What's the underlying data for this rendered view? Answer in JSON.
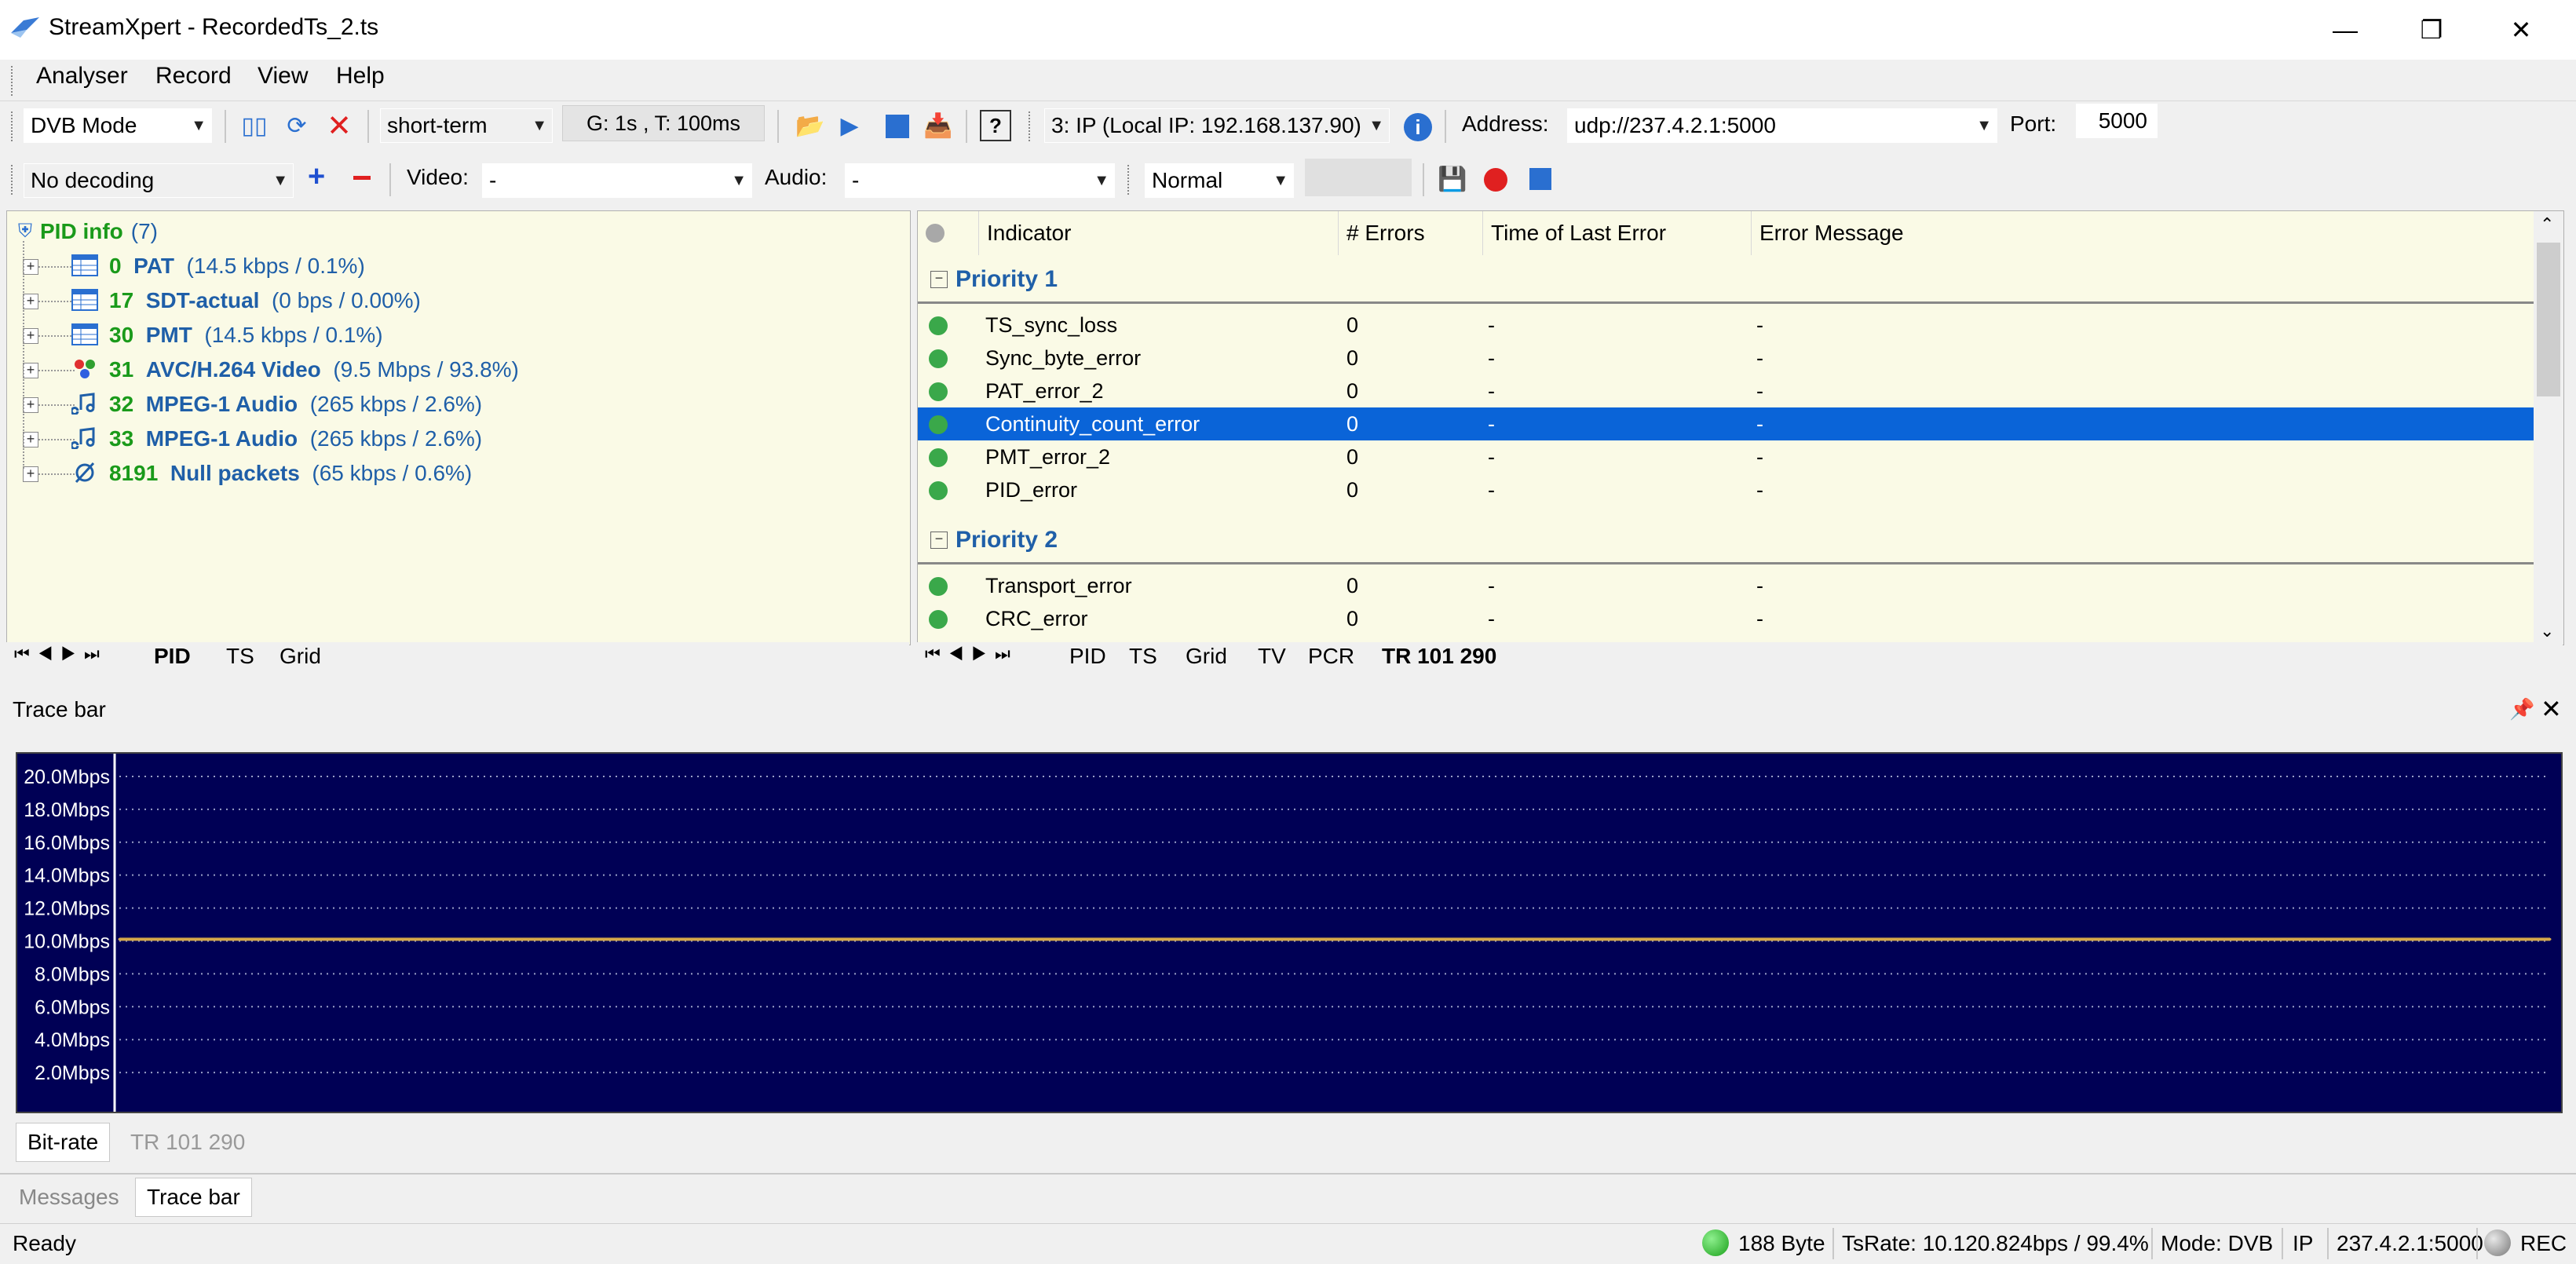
{
  "window": {
    "title": "StreamXpert - RecordedTs_2.ts",
    "controls": [
      "minimize",
      "restore",
      "close"
    ]
  },
  "menu": {
    "items": [
      {
        "label": "Analyser"
      },
      {
        "label": "Record"
      },
      {
        "label": "View"
      },
      {
        "label": "Help"
      }
    ]
  },
  "toolbar1": {
    "mode": "DVB Mode",
    "term": "short-term",
    "interval": "G: 1s , T: 100ms",
    "input_source": "3: IP (Local IP: 192.168.137.90)",
    "address_label": "Address:",
    "address": "udp://237.4.2.1:5000",
    "port_label": "Port:",
    "port": "5000"
  },
  "toolbar2": {
    "decoding": "No decoding",
    "video_label": "Video:",
    "video_value": "-",
    "audio_label": "Audio:",
    "audio_value": "-",
    "speed": "Normal"
  },
  "pid_tree": {
    "root_label": "PID info",
    "root_count": "(7)",
    "items": [
      {
        "pid": "0",
        "name": "PAT",
        "rate": "(14.5 kbps / 0.1%)",
        "icon": "table-icon"
      },
      {
        "pid": "17",
        "name": "SDT-actual",
        "rate": "(0 bps / 0.00%)",
        "icon": "table-icon"
      },
      {
        "pid": "30",
        "name": "PMT",
        "rate": "(14.5 kbps / 0.1%)",
        "icon": "table-icon"
      },
      {
        "pid": "31",
        "name": "AVC/H.264 Video",
        "rate": "(9.5 Mbps / 93.8%)",
        "icon": "video-icon"
      },
      {
        "pid": "32",
        "name": "MPEG-1 Audio",
        "rate": "(265 kbps / 2.6%)",
        "icon": "audio-icon"
      },
      {
        "pid": "33",
        "name": "MPEG-1 Audio",
        "rate": "(265 kbps / 2.6%)",
        "icon": "audio-icon"
      },
      {
        "pid": "8191",
        "name": "Null packets",
        "rate": "(65 kbps / 0.6%)",
        "icon": "null-icon"
      }
    ]
  },
  "left_tabs": [
    "PID",
    "TS",
    "Grid"
  ],
  "tr_table": {
    "columns": [
      "Indicator",
      "# Errors",
      "Time of Last Error",
      "Error Message"
    ],
    "groups": [
      {
        "label": "Priority 1",
        "rows": [
          {
            "indicator": "TS_sync_loss",
            "errors": "0",
            "time": "-",
            "message": "-"
          },
          {
            "indicator": "Sync_byte_error",
            "errors": "0",
            "time": "-",
            "message": "-"
          },
          {
            "indicator": "PAT_error_2",
            "errors": "0",
            "time": "-",
            "message": "-"
          },
          {
            "indicator": "Continuity_count_error",
            "errors": "0",
            "time": "-",
            "message": "-",
            "selected": true
          },
          {
            "indicator": "PMT_error_2",
            "errors": "0",
            "time": "-",
            "message": "-"
          },
          {
            "indicator": "PID_error",
            "errors": "0",
            "time": "-",
            "message": "-"
          }
        ]
      },
      {
        "label": "Priority 2",
        "rows": [
          {
            "indicator": "Transport_error",
            "errors": "0",
            "time": "-",
            "message": "-"
          },
          {
            "indicator": "CRC_error",
            "errors": "0",
            "time": "-",
            "message": "-"
          }
        ]
      }
    ]
  },
  "right_tabs": [
    "PID",
    "TS",
    "Grid",
    "TV",
    "PCR",
    "TR 101 290"
  ],
  "trace_bar": {
    "title": "Trace bar",
    "tabs": [
      "Bit-rate",
      "TR 101 290"
    ]
  },
  "chart_data": {
    "type": "line",
    "y_tick_labels": [
      "20.0Mbps",
      "18.0Mbps",
      "16.0Mbps",
      "14.0Mbps",
      "12.0Mbps",
      "10.0Mbps",
      "8.0Mbps",
      "6.0Mbps",
      "4.0Mbps",
      "2.0Mbps"
    ],
    "y_ticks": [
      20,
      18,
      16,
      14,
      12,
      10,
      8,
      6,
      4,
      2
    ],
    "ylim": [
      0,
      21
    ],
    "grid": true,
    "series": [
      {
        "color": "#d4a84a",
        "y": [
          10.1,
          10.1,
          10.1,
          10.1,
          10.1,
          10.1,
          10.1,
          10.1,
          10.1,
          10.1,
          10.1,
          10.1
        ]
      }
    ],
    "background": "#000055"
  },
  "dock_tabs": [
    "Messages",
    "Trace bar"
  ],
  "status": {
    "ready": "Ready",
    "packet_size": "188 Byte",
    "ts_rate": "TsRate: 10.120.824bps / 99.4%",
    "mode": "Mode: DVB",
    "ip_label": "IP",
    "ip": "237.4.2.1:5000",
    "rec": "REC"
  },
  "colors": {
    "selection": "#0a64d8",
    "ok_dot": "#3aa84a",
    "pid_green": "#1a9a1a",
    "pid_blue": "#1f5fa8",
    "pane_bg": "#fafae6"
  }
}
